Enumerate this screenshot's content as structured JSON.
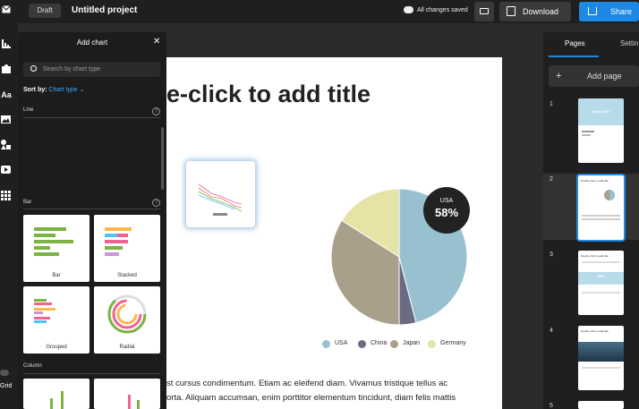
{
  "topbar": {
    "status_badge": "Draft",
    "project_title": "Untitled project",
    "save_status": "All changes saved",
    "download_label": "Download",
    "share_label": "Share"
  },
  "rail": {
    "icons": [
      "mail-icon",
      "chart-icon",
      "image-shape-icon",
      "text-icon",
      "photo-icon",
      "shapes-icon",
      "video-icon",
      "grid-apps-icon"
    ],
    "text_label": "Aa",
    "grid_label": "Grid"
  },
  "panel": {
    "title": "Add chart",
    "search_placeholder": "Search by chart type",
    "sort_prefix": "Sort by:",
    "sort_value": "Chart type",
    "sections": {
      "line": "Line",
      "bar": "Bar",
      "column": "Column"
    },
    "tiles": {
      "bar": "Bar",
      "stacked": "Stacked",
      "grouped": "Grouped",
      "radial": "Radial"
    }
  },
  "canvas": {
    "title_text": "e-click to add title",
    "tooltip_label": "USA",
    "tooltip_value": "58%",
    "body_line1": "st cursus condimentum. Etiam ac eleifend diam. Vivamus tristique tellus ac",
    "body_line2": "orta. Aliquam accumsan, enim porttitor elementum tincidunt, diam felis mattis"
  },
  "chart_data": {
    "type": "pie",
    "categories": [
      "USA",
      "China",
      "Japan",
      "Germany"
    ],
    "values": [
      46,
      4,
      34,
      16
    ],
    "colors": [
      "#98c1cf",
      "#6b6b83",
      "#a8a08a",
      "#e6e3a6"
    ],
    "highlighted": {
      "category": "USA",
      "label": "58%"
    },
    "legend_placement": "bottom"
  },
  "right": {
    "tab_pages": "Pages",
    "tab_settings": "Settin",
    "add_page_label": "Add page",
    "page_numbers": [
      "1",
      "2",
      "3",
      "4",
      "5"
    ],
    "thumb1_title": "Report Title",
    "thumb2_title": "Double click to add title",
    "thumb3_title": "Double click to add title",
    "thumb3_stat": "45%",
    "thumb4_title": "Double click to add title"
  }
}
